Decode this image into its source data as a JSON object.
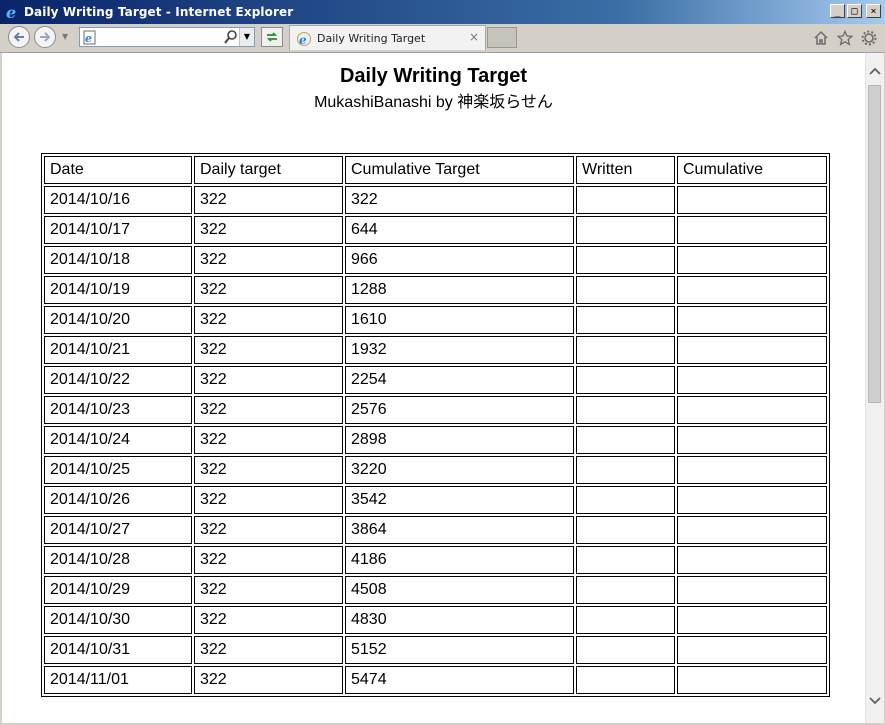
{
  "window": {
    "title": "Daily Writing Target - Internet Explorer",
    "buttons": {
      "minimize": "_",
      "maximize": "□",
      "close": "×"
    }
  },
  "navbar": {
    "address_value": "",
    "tab_label": "Daily Writing Target",
    "tab_close": "×",
    "icons": [
      "back-arrow-icon",
      "forward-arrow-icon",
      "search-icon",
      "refresh-icon",
      "home-icon",
      "favorites-star-icon",
      "gear-icon"
    ]
  },
  "page": {
    "title": "Daily Writing Target",
    "subtitle": "MukashiBanashi by 神楽坂らせん"
  },
  "table": {
    "headers": [
      "Date",
      "Daily target",
      "Cumulative Target",
      "Written",
      "Cumulative"
    ],
    "rows": [
      [
        "2014/10/16",
        "322",
        "322",
        "",
        ""
      ],
      [
        "2014/10/17",
        "322",
        "644",
        "",
        ""
      ],
      [
        "2014/10/18",
        "322",
        "966",
        "",
        ""
      ],
      [
        "2014/10/19",
        "322",
        "1288",
        "",
        ""
      ],
      [
        "2014/10/20",
        "322",
        "1610",
        "",
        ""
      ],
      [
        "2014/10/21",
        "322",
        "1932",
        "",
        ""
      ],
      [
        "2014/10/22",
        "322",
        "2254",
        "",
        ""
      ],
      [
        "2014/10/23",
        "322",
        "2576",
        "",
        ""
      ],
      [
        "2014/10/24",
        "322",
        "2898",
        "",
        ""
      ],
      [
        "2014/10/25",
        "322",
        "3220",
        "",
        ""
      ],
      [
        "2014/10/26",
        "322",
        "3542",
        "",
        ""
      ],
      [
        "2014/10/27",
        "322",
        "3864",
        "",
        ""
      ],
      [
        "2014/10/28",
        "322",
        "4186",
        "",
        ""
      ],
      [
        "2014/10/29",
        "322",
        "4508",
        "",
        ""
      ],
      [
        "2014/10/30",
        "322",
        "4830",
        "",
        ""
      ],
      [
        "2014/10/31",
        "322",
        "5152",
        "",
        ""
      ],
      [
        "2014/11/01",
        "322",
        "5474",
        "",
        ""
      ]
    ]
  },
  "colors": {
    "titlebar_start": "#0a246a",
    "chrome": "#d4d0c8",
    "border": "#000000"
  }
}
